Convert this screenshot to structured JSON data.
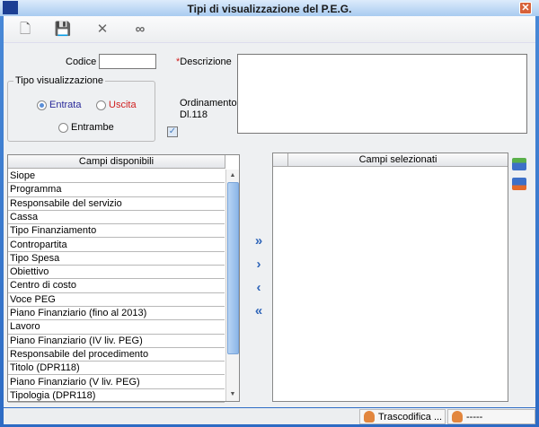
{
  "window": {
    "title": "Tipi di visualizzazione del P.E.G.",
    "close": "✕"
  },
  "toolbar": [
    {
      "name": "new-icon",
      "glyph": "🗋"
    },
    {
      "name": "save-icon",
      "glyph": "💾"
    },
    {
      "name": "delete-icon",
      "glyph": "✕"
    },
    {
      "name": "search-binoculars-icon",
      "glyph": "∞"
    }
  ],
  "form": {
    "codice_label": "Codice",
    "codice_value": "",
    "required_mark": "*",
    "descrizione_label": "Descrizione",
    "descrizione_value": "",
    "tipo_group": "Tipo visualizzazione",
    "radio_entrata": "Entrata",
    "radio_uscita": "Uscita",
    "radio_entrambe": "Entrambe",
    "selected": "Entrata",
    "ordinamento_label1": "Ordinamento",
    "ordinamento_label2": "Dl.118",
    "ordinamento_checked": true
  },
  "available": {
    "header": "Campi disponibili",
    "items": [
      "Siope",
      "Programma",
      "Responsabile del servizio",
      "Cassa",
      "Tipo Finanziamento",
      "Contropartita",
      "Tipo Spesa",
      "Obiettivo",
      "Centro di costo",
      "Voce PEG",
      "Piano Finanziario (fino al 2013)",
      "Lavoro",
      "Piano Finanziario (IV liv. PEG)",
      "Responsabile del procedimento",
      "Titolo (DPR118)",
      "Piano Finanziario (V liv. PEG)",
      "Tipologia (DPR118)"
    ]
  },
  "selected": {
    "header": "Campi selezionati",
    "items": []
  },
  "move": {
    "all_right": "»",
    "right": "›",
    "left": "‹",
    "all_left": "«"
  },
  "status": {
    "trascodifica": "Trascodifica ...",
    "user": "-----"
  },
  "colors": {
    "accent": "#2f65b8",
    "uscita": "#d02020",
    "entrata": "#2a2a9a",
    "required": "#d02020"
  }
}
